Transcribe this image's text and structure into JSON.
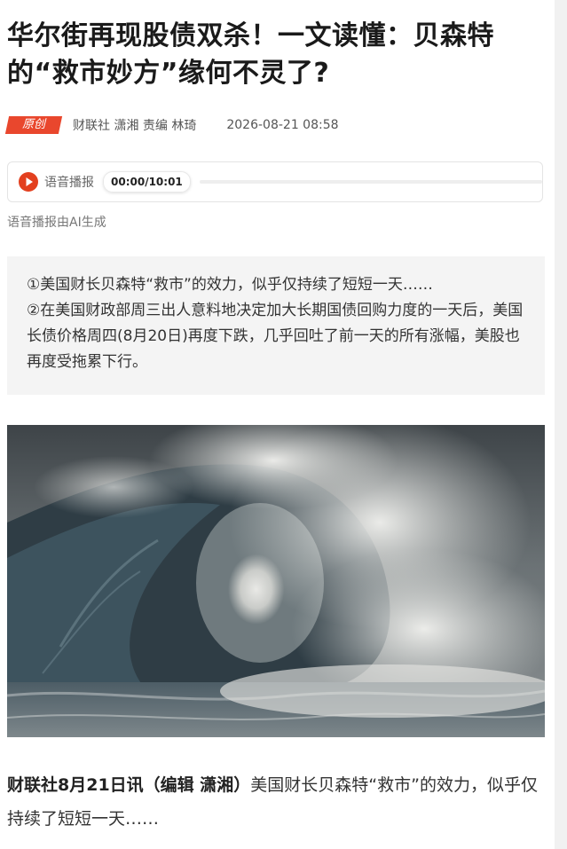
{
  "article": {
    "title": "华尔街再现股债双杀！一文读懂：贝森特的“救市妙方”缘何不灵了?",
    "badge": "原创",
    "author": "财联社 潇湘  责编 林琦",
    "datetime": "2026-08-21 08:58"
  },
  "audio": {
    "label": "语音播报",
    "time": "00:00/10:01",
    "progress": 0,
    "ai_note": "语音播报由AI生成"
  },
  "summary": {
    "lines": [
      "①美国财长贝森特“救市”的效力，似乎仅持续了短短一天……",
      "②在美国财政部周三出人意料地决定加大长期国债回购力度的一天后，美国长债价格周四(8月20日)再度下跌，几乎回吐了前一天的所有涨幅，美股也再度受拖累下行。"
    ]
  },
  "lead": {
    "dateline": "财联社8月21日讯（编辑 潇湘）",
    "text": "美国财长贝森特“救市”的效力，似乎仅持续了短短一天……"
  },
  "colors": {
    "badge": "#e9472d",
    "play_button": "#e3401f",
    "summary_bg": "#f4f4f4"
  },
  "icons": {
    "play": "play-icon"
  }
}
